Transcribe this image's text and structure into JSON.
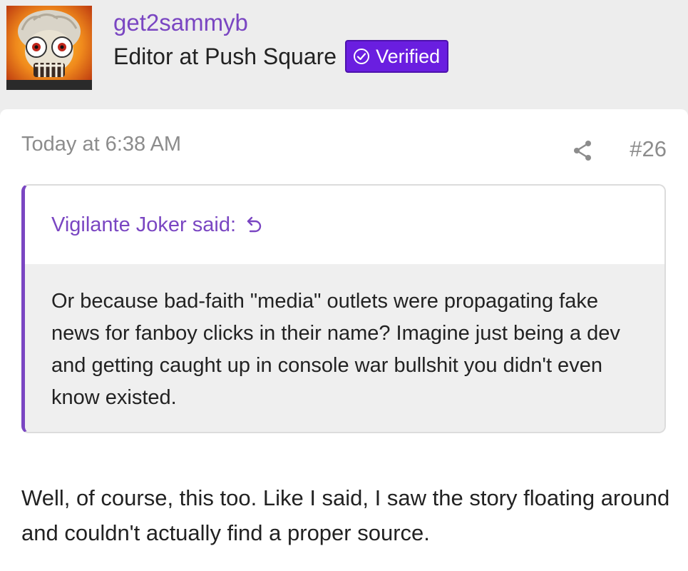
{
  "author": {
    "username": "get2sammyb",
    "title": "Editor at Push Square",
    "badge": "Verified"
  },
  "post": {
    "timestamp": "Today at 6:38 AM",
    "number": "#26",
    "quote": {
      "attribution": "Vigilante Joker said:",
      "text": "Or because bad-faith \"media\" outlets were propagating fake news for fanboy clicks in their name? Imagine just being a dev and getting caught up in console war bullshit you didn't even know existed."
    },
    "body": "Well, of course, this too. Like I said, I saw the story floating around and couldn't actually find a proper source."
  },
  "colors": {
    "accent": "#7a46c2",
    "badge": "#6a1ee0",
    "muted": "#8c8c8c"
  },
  "icons": {
    "share": "share-icon",
    "jump": "jump-to-quote-icon",
    "verified": "check-circle-icon"
  }
}
